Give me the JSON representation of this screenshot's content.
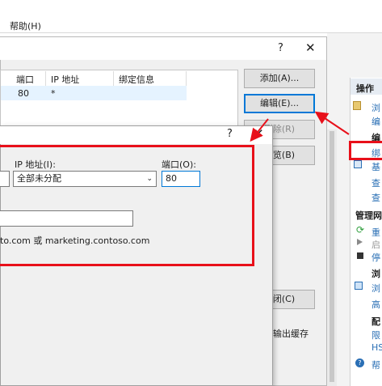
{
  "menubar": {
    "help": "帮助(H)"
  },
  "dialog_bindings": {
    "help_glyph": "?",
    "close_glyph": "✕",
    "columns": [
      "端口",
      "IP 地址",
      "绑定信息"
    ],
    "row": {
      "port": "80",
      "ip": "*"
    },
    "buttons": {
      "add": "添加(A)...",
      "edit": "编辑(E)...",
      "remove": "删除(R)",
      "browse": "浏览(B)",
      "close": "关闭(C)"
    }
  },
  "dialog_edit": {
    "help_glyph": "?",
    "close_glyph": "✕",
    "ip_label": "IP 地址(I):",
    "ip_value": "全部未分配",
    "port_label": "端口(O):",
    "port_value": "80",
    "hostname_value": "",
    "example_text": "to.com 或 marketing.contoso.com"
  },
  "actions_panel": {
    "header": "操作",
    "items": [
      "浏",
      "编",
      "编",
      "绑",
      "基",
      "查",
      "查"
    ],
    "section_manage": "管理网",
    "manage_items": [
      "重",
      "启",
      "停"
    ],
    "section_browse": "浏",
    "browse_items": [
      "浏",
      "高"
    ],
    "section_config": "配",
    "config_items": [
      "限",
      "HS"
    ],
    "help": "帮"
  },
  "background_text": {
    "output_cache": "输出缓存"
  },
  "colors": {
    "annotation_red": "#e8101a",
    "accent_blue": "#0078d7"
  }
}
